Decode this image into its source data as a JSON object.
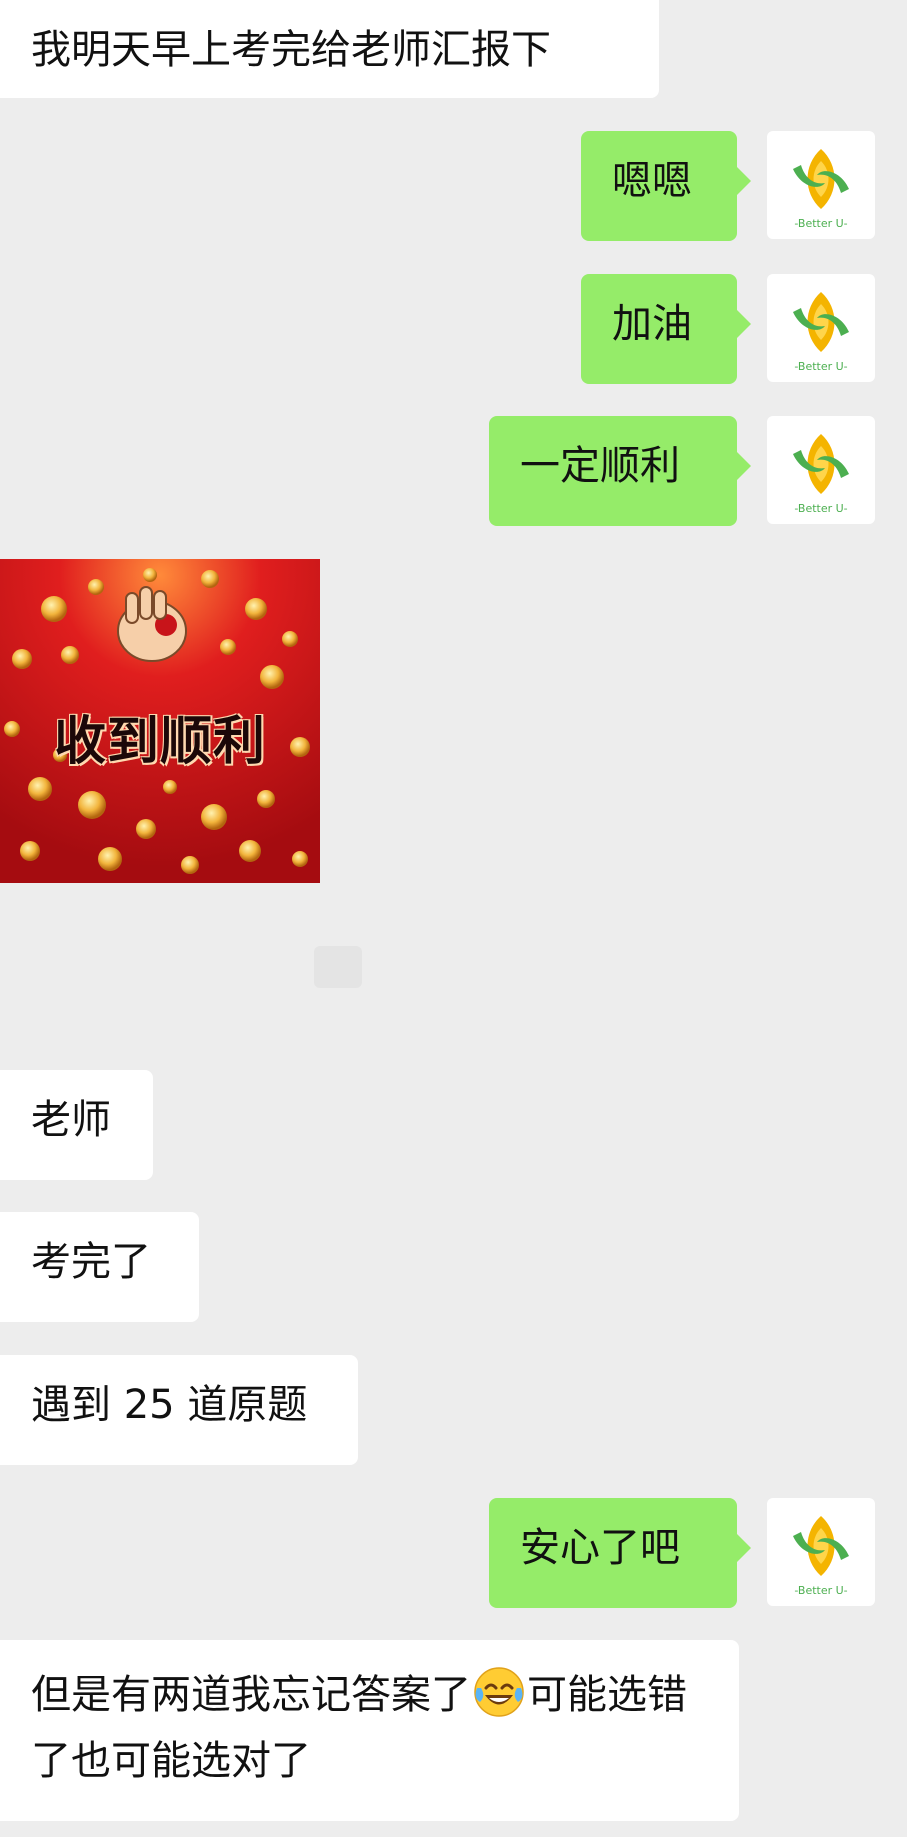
{
  "messages": [
    {
      "side": "in",
      "text": "我明天早上考完给老师汇报下"
    },
    {
      "side": "out",
      "text": "嗯嗯"
    },
    {
      "side": "out",
      "text": "加油"
    },
    {
      "side": "out",
      "text": "一定顺利"
    },
    {
      "side": "in",
      "type": "sticker",
      "text": "收到顺利"
    },
    {
      "side": "in",
      "text": "老师"
    },
    {
      "side": "in",
      "text": "考完了"
    },
    {
      "side": "in",
      "text": "遇到 25 道原题"
    },
    {
      "side": "out",
      "text": "安心了吧"
    },
    {
      "side": "in",
      "text_before_emoji": "但是有两道我忘记答案了",
      "emoji": "tears-of-joy-emoji",
      "text_after_emoji": "可能选错了也可能选对了"
    }
  ],
  "avatar": {
    "label": "-Better U-",
    "icon": "better-u-logo-icon"
  },
  "colors": {
    "background": "#ededed",
    "incoming": "#ffffff",
    "outgoing": "#95ec69",
    "sticker_red": "#c8141a"
  }
}
